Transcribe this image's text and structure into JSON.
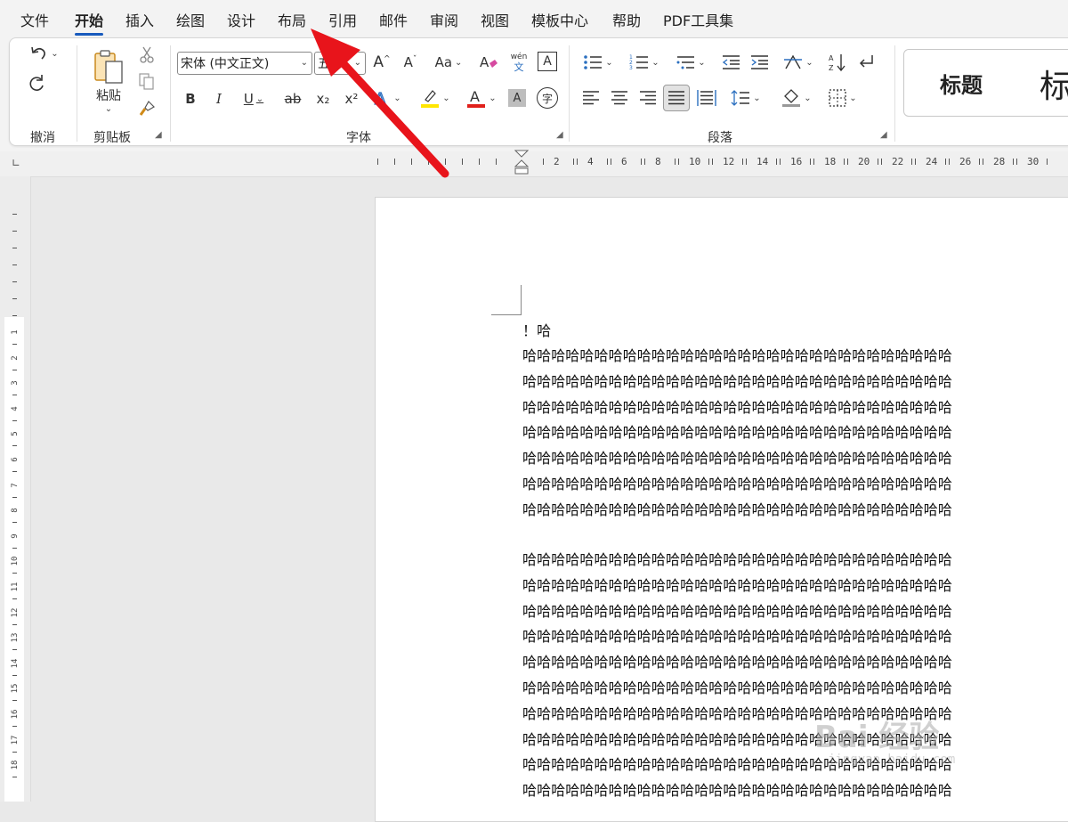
{
  "menu": {
    "tabs": [
      "文件",
      "开始",
      "插入",
      "绘图",
      "设计",
      "布局",
      "引用",
      "邮件",
      "审阅",
      "视图",
      "模板中心",
      "帮助",
      "PDF工具集"
    ],
    "active_tab": "开始"
  },
  "ribbon": {
    "undo_group": {
      "label": "撤消"
    },
    "clipboard_group": {
      "label": "剪贴板",
      "paste_label": "粘贴"
    },
    "font_group": {
      "label": "字体",
      "font_name": "宋体 (中文正文)",
      "font_size": "五号",
      "bold": "B",
      "italic": "I",
      "underline": "U",
      "strike": "ab",
      "subscript": "x₂",
      "superscript": "x²",
      "change_case": "Aa",
      "phonetic_top": "wén",
      "phonetic_bottom": "文",
      "char_border": "A",
      "char_shading": "A",
      "enclose": "字",
      "grow": "A^",
      "shrink": "Aˇ",
      "highlight_color": "#ffe600",
      "font_color": "#e0201b"
    },
    "paragraph_group": {
      "label": "段落"
    },
    "styles": {
      "heading_label": "标题",
      "heading_partial": "标"
    }
  },
  "ruler": {
    "h_numbers": [
      "2",
      "4",
      "6",
      "8",
      "10",
      "12",
      "14",
      "16",
      "18",
      "20",
      "22",
      "24",
      "26",
      "28",
      "30"
    ],
    "v_numbers": [
      "1",
      "2",
      "3",
      "4",
      "5",
      "6",
      "7",
      "8",
      "9",
      "10",
      "11",
      "12",
      "13",
      "14",
      "15",
      "16",
      "17",
      "18"
    ]
  },
  "document": {
    "first_line": "！哈",
    "para1": [
      "哈哈哈哈哈哈哈哈哈哈哈哈哈哈哈哈哈哈哈哈哈哈哈哈哈哈哈哈哈哈",
      "哈哈哈哈哈哈哈哈哈哈哈哈哈哈哈哈哈哈哈哈哈哈哈哈哈哈哈哈哈哈",
      "哈哈哈哈哈哈哈哈哈哈哈哈哈哈哈哈哈哈哈哈哈哈哈哈哈哈哈哈哈哈",
      "哈哈哈哈哈哈哈哈哈哈哈哈哈哈哈哈哈哈哈哈哈哈哈哈哈哈哈哈哈哈",
      "哈哈哈哈哈哈哈哈哈哈哈哈哈哈哈哈哈哈哈哈哈哈哈哈哈哈哈哈哈哈",
      "哈哈哈哈哈哈哈哈哈哈哈哈哈哈哈哈哈哈哈哈哈哈哈哈哈哈哈哈哈哈",
      "哈哈哈哈哈哈哈哈哈哈哈哈哈哈哈哈哈哈哈哈哈哈哈哈哈哈哈哈哈哈"
    ],
    "para2": [
      "哈哈哈哈哈哈哈哈哈哈哈哈哈哈哈哈哈哈哈哈哈哈哈哈哈哈哈哈哈哈",
      "哈哈哈哈哈哈哈哈哈哈哈哈哈哈哈哈哈哈哈哈哈哈哈哈哈哈哈哈哈哈",
      "哈哈哈哈哈哈哈哈哈哈哈哈哈哈哈哈哈哈哈哈哈哈哈哈哈哈哈哈哈哈",
      "哈哈哈哈哈哈哈哈哈哈哈哈哈哈哈哈哈哈哈哈哈哈哈哈哈哈哈哈哈哈",
      "哈哈哈哈哈哈哈哈哈哈哈哈哈哈哈哈哈哈哈哈哈哈哈哈哈哈哈哈哈哈",
      "哈哈哈哈哈哈哈哈哈哈哈哈哈哈哈哈哈哈哈哈哈哈哈哈哈哈哈哈哈哈",
      "哈哈哈哈哈哈哈哈哈哈哈哈哈哈哈哈哈哈哈哈哈哈哈哈哈哈哈哈哈哈",
      "哈哈哈哈哈哈哈哈哈哈哈哈哈哈哈哈哈哈哈哈哈哈哈哈哈哈哈哈哈哈",
      "哈哈哈哈哈哈哈哈哈哈哈哈哈哈哈哈哈哈哈哈哈哈哈哈哈哈哈哈哈哈",
      "哈哈哈哈哈哈哈哈哈哈哈哈哈哈哈哈哈哈哈哈哈哈哈哈哈哈哈哈哈哈"
    ]
  },
  "annotation": {
    "arrow_color": "#e8141b",
    "points_to": "布局"
  },
  "watermark": {
    "text": "Bai 经验",
    "url": "jingyan.baidu.com"
  }
}
